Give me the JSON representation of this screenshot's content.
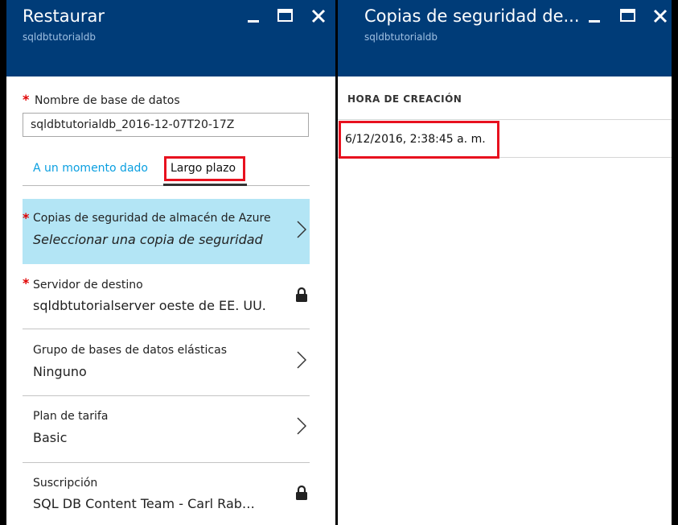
{
  "left_blade": {
    "title": "Restaurar",
    "subtitle": "sqldbtutorialdb",
    "required_mark": "*",
    "db_name_label": "Nombre de base de datos",
    "db_name_value": "sqldbtutorialdb_2016-12-07T20-17Z",
    "tabs": [
      {
        "label": "A un momento dado"
      },
      {
        "label": "Largo plazo"
      }
    ],
    "rows": [
      {
        "label": "Copias de seguridad de almacén de Azure",
        "value": "Seleccionar una copia de seguridad",
        "icon": "chevron-right-icon"
      },
      {
        "label": "Servidor de destino",
        "value": "sqldbtutorialserver oeste de EE. UU.",
        "icon": "lock-icon"
      },
      {
        "label": "Grupo de bases de datos elásticas",
        "value": "Ninguno",
        "icon": "chevron-right-icon"
      },
      {
        "label": "Plan de tarifa",
        "value": "Basic",
        "icon": "chevron-right-icon"
      },
      {
        "label": "Suscripción",
        "value": "SQL DB Content Team - Carl Rab…",
        "icon": "lock-icon"
      }
    ]
  },
  "right_blade": {
    "title": "Copias de seguridad de...",
    "subtitle": "sqldbtutorialdb",
    "column_header": "HORA DE CREACIÓN",
    "backups": [
      {
        "created": "6/12/2016, 2:38:45 a. m."
      }
    ]
  },
  "colors": {
    "header_bg": "#003c78",
    "selected_row_bg": "#b3e5f5",
    "highlight": "#e8111f",
    "link": "#0a9fe0",
    "required": "#e00000"
  }
}
